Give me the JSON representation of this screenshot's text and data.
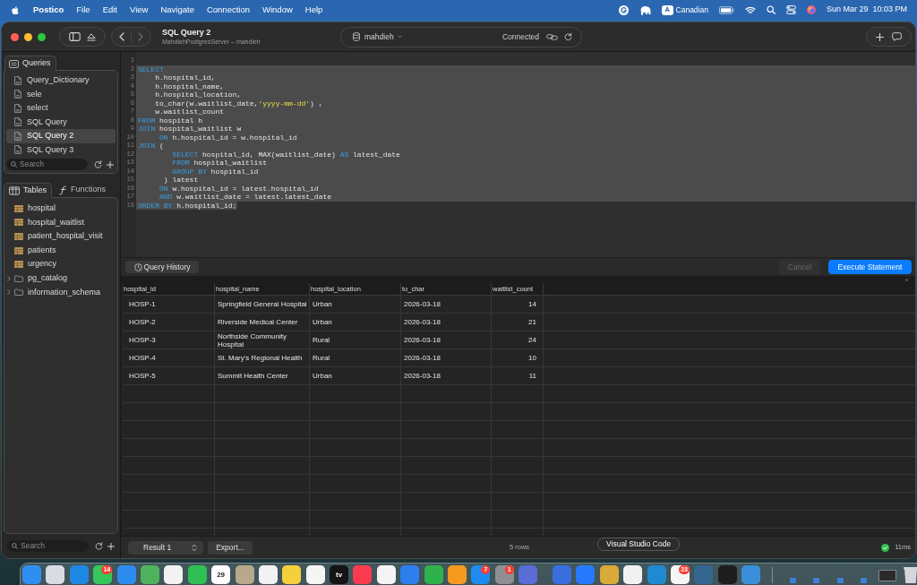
{
  "menu_bar": {
    "app_name": "Postico",
    "menus": [
      "File",
      "Edit",
      "View",
      "Navigate",
      "Connection",
      "Window",
      "Help"
    ],
    "input_source": {
      "key": "A",
      "label": "Canadian"
    },
    "date": "Sun Mar 29",
    "time": "10:03 PM"
  },
  "window": {
    "title": "SQL Query 2",
    "subtitle": "MahdiehPostgresServer – mahdieh",
    "database": "mahdieh",
    "status": "Connected"
  },
  "sidebar": {
    "queries_tab": {
      "label": "Queries"
    },
    "queries": [
      {
        "label": "Query_Dictionary",
        "selected": false
      },
      {
        "label": "sele",
        "selected": false
      },
      {
        "label": "select",
        "selected": false
      },
      {
        "label": "SQL Query",
        "selected": false
      },
      {
        "label": "SQL Query 2",
        "selected": true
      },
      {
        "label": "SQL Query 3",
        "selected": false
      }
    ],
    "queries_search": {
      "placeholder": "Search"
    },
    "object_tabs": [
      {
        "label": "Tables",
        "kind": "table",
        "selected": true
      },
      {
        "label": "Functions",
        "kind": "function",
        "selected": false
      }
    ],
    "objects": [
      {
        "label": "hospital",
        "kind": "table"
      },
      {
        "label": "hospital_waitlist",
        "kind": "table"
      },
      {
        "label": "patient_hospital_visit",
        "kind": "table"
      },
      {
        "label": "patients",
        "kind": "table"
      },
      {
        "label": "urgency",
        "kind": "table"
      },
      {
        "label": "pg_catalog",
        "kind": "schema",
        "expanded": false
      },
      {
        "label": "information_schema",
        "kind": "schema",
        "expanded": false
      }
    ],
    "objects_search": {
      "placeholder": "Search"
    }
  },
  "editor": {
    "lines": [
      {
        "number": "1",
        "selected": false
      },
      {
        "number": "2",
        "selected": true,
        "tokens": [
          {
            "kind": "keyword",
            "text": "SELECT"
          }
        ]
      },
      {
        "number": "3",
        "selected": true,
        "tokens": [
          {
            "kind": "plain",
            "text": "    h.hospital_id,"
          }
        ]
      },
      {
        "number": "4",
        "selected": true,
        "tokens": [
          {
            "kind": "plain",
            "text": "    h.hospital_name,"
          }
        ]
      },
      {
        "number": "5",
        "selected": true,
        "tokens": [
          {
            "kind": "plain",
            "text": "    h.hospital_location,"
          }
        ]
      },
      {
        "number": "6",
        "selected": true,
        "tokens": [
          {
            "kind": "plain",
            "text": "    to_char(w.waitlist_date,"
          },
          {
            "kind": "string",
            "text": "'yyyy-mm-dd'"
          },
          {
            "kind": "plain",
            "text": ") ,"
          }
        ]
      },
      {
        "number": "7",
        "selected": true,
        "tokens": [
          {
            "kind": "plain",
            "text": "    w.waitlist_count"
          }
        ]
      },
      {
        "number": "8",
        "selected": true,
        "tokens": [
          {
            "kind": "keyword",
            "text": "FROM"
          },
          {
            "kind": "plain",
            "text": " hospital h"
          }
        ]
      },
      {
        "number": "9",
        "selected": true,
        "tokens": [
          {
            "kind": "keyword",
            "text": "JOIN"
          },
          {
            "kind": "plain",
            "text": " hospital_waitlist w"
          }
        ]
      },
      {
        "number": "10",
        "selected": true,
        "tokens": [
          {
            "kind": "keyword",
            "text": "     ON"
          },
          {
            "kind": "plain",
            "text": " h.hospital_id = w.hospital_id"
          }
        ]
      },
      {
        "number": "11",
        "selected": true,
        "tokens": [
          {
            "kind": "keyword",
            "text": "JOIN"
          },
          {
            "kind": "plain",
            "text": " ("
          }
        ]
      },
      {
        "number": "12",
        "selected": true,
        "tokens": [
          {
            "kind": "keyword",
            "text": "        SELECT"
          },
          {
            "kind": "plain",
            "text": " hospital_id, MAX(waitlist_date) "
          },
          {
            "kind": "keyword",
            "text": "AS"
          },
          {
            "kind": "plain",
            "text": " latest_date"
          }
        ]
      },
      {
        "number": "13",
        "selected": true,
        "tokens": [
          {
            "kind": "keyword",
            "text": "        FROM"
          },
          {
            "kind": "plain",
            "text": " hospital_waitlist"
          }
        ]
      },
      {
        "number": "14",
        "selected": true,
        "tokens": [
          {
            "kind": "keyword",
            "text": "        GROUP BY"
          },
          {
            "kind": "plain",
            "text": " hospital_id"
          }
        ]
      },
      {
        "number": "15",
        "selected": true,
        "tokens": [
          {
            "kind": "plain",
            "text": "      ) latest"
          }
        ]
      },
      {
        "number": "16",
        "selected": true,
        "tokens": [
          {
            "kind": "keyword",
            "text": "     ON"
          },
          {
            "kind": "plain",
            "text": " w.hospital_id = latest.hospital_id"
          }
        ]
      },
      {
        "number": "17",
        "selected": true,
        "tokens": [
          {
            "kind": "keyword",
            "text": "     AND"
          },
          {
            "kind": "plain",
            "text": " w.waitlist_date = latest.latest_date"
          }
        ]
      },
      {
        "number": "18",
        "selected": true,
        "tokens": [
          {
            "kind": "keyword",
            "text": "ORDER BY"
          },
          {
            "kind": "plain",
            "text": " h.hospital_id;"
          }
        ]
      }
    ]
  },
  "actions": {
    "query_history": "Query History",
    "cancel": {
      "label": "Cancel",
      "disabled": true
    },
    "execute": {
      "label": "Execute Statement",
      "disabled": false
    }
  },
  "results": {
    "columns": [
      {
        "label": "hospital_id",
        "kind": "text"
      },
      {
        "label": "hospital_name",
        "kind": "text"
      },
      {
        "label": "hospital_location",
        "kind": "text"
      },
      {
        "label": "to_char",
        "kind": "text"
      },
      {
        "label": "waitlist_count",
        "kind": "number"
      }
    ],
    "rows": [
      [
        "HOSP-1",
        "Springfield General Hospital",
        "Urban",
        "2026-03-18",
        "14"
      ],
      [
        "HOSP-2",
        "Riverside Medical Center",
        "Urban",
        "2026-03-18",
        "21"
      ],
      [
        "HOSP-3",
        "Northside Community Hospital",
        "Rural",
        "2026-03-18",
        "24"
      ],
      [
        "HOSP-4",
        "St. Mary's Regional Health",
        "Rural",
        "2026-03-18",
        "10"
      ],
      [
        "HOSP-5",
        "Summit Health Center",
        "Urban",
        "2026-03-18",
        "11"
      ]
    ]
  },
  "status_bar": {
    "result_selector": "Result 1",
    "export": "Export...",
    "row_count": "5 rows",
    "duration": "11ms"
  },
  "tooltip": {
    "text": "Visual Studio Code"
  },
  "dock": {
    "sections": [
      [
        {
          "kind": "app",
          "color": "#2f8ff0"
        },
        {
          "kind": "app",
          "color": "#d9dbe3"
        },
        {
          "kind": "app",
          "color": "#1e88e5"
        },
        {
          "kind": "app",
          "color": "#34c759",
          "badge": "14"
        },
        {
          "kind": "app",
          "color": "#2d8cf0"
        },
        {
          "kind": "app",
          "color": "#4fb35d"
        },
        {
          "kind": "app",
          "color": "#f2f2f2"
        },
        {
          "kind": "app",
          "color": "#2fbf55"
        },
        {
          "kind": "app",
          "color": "#ffffff",
          "text": "29"
        },
        {
          "kind": "app",
          "color": "#b9a88c"
        },
        {
          "kind": "app",
          "color": "#f2f2f2"
        },
        {
          "kind": "app",
          "color": "#f6cf3d"
        },
        {
          "kind": "app",
          "color": "#f5f5f5"
        },
        {
          "kind": "app",
          "color": "#141414",
          "text": "tv"
        },
        {
          "kind": "app",
          "color": "#fb3b50"
        },
        {
          "kind": "app",
          "color": "#f4f4f4"
        },
        {
          "kind": "app",
          "color": "#2d7ff0"
        },
        {
          "kind": "app",
          "color": "#2fb24c"
        },
        {
          "kind": "app",
          "color": "#f39a1f"
        },
        {
          "kind": "app",
          "color": "#1d8cf0",
          "badge": "7"
        },
        {
          "kind": "app",
          "color": "#8e8e93",
          "badge": "1"
        },
        {
          "kind": "app",
          "color": "#5a6cd6"
        }
      ],
      [
        {
          "kind": "app",
          "color": "#3b6fe0"
        },
        {
          "kind": "app",
          "color": "#2979ff"
        },
        {
          "kind": "app",
          "color": "#d9a93a"
        },
        {
          "kind": "app",
          "color": "#f1f1f1"
        },
        {
          "kind": "app",
          "color": "#1f8ad2"
        },
        {
          "kind": "app",
          "color": "#f5f5f5",
          "badge": "23"
        },
        {
          "kind": "app",
          "color": "#336791"
        },
        {
          "kind": "app",
          "color": "#1d1d1d"
        },
        {
          "kind": "app",
          "color": "#3b8fd9"
        }
      ],
      [
        {
          "kind": "thumbnail",
          "color": "#3f7fd8"
        },
        {
          "kind": "thumbnail",
          "color": "#3f7fd8"
        },
        {
          "kind": "thumbnail",
          "color": "#3f7fd8"
        },
        {
          "kind": "thumbnail",
          "color": "#3f7fd8"
        },
        {
          "kind": "window",
          "color": "#2b2b2b"
        },
        {
          "kind": "trash",
          "color": "#d4d6dc"
        }
      ]
    ]
  }
}
